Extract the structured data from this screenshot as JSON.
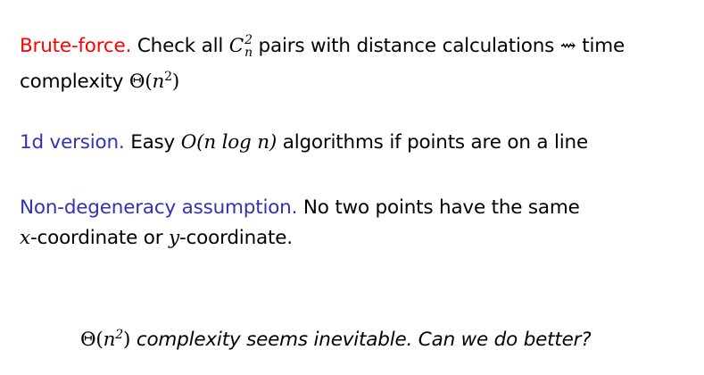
{
  "brute_force": {
    "heading": "Brute-force.",
    "text_before": "Check all",
    "math_C": "C",
    "math_sup": "2",
    "math_sub": "n",
    "text_after": "pairs with distance calculations",
    "arrow": "⇝",
    "text_end": "time complexity",
    "math_theta": "Θ(",
    "math_n": "n",
    "math_exp": "2",
    "math_close": ")"
  },
  "one_d": {
    "heading": "1d version.",
    "text_before": "Easy",
    "math": "O(n log n)",
    "text_after": "algorithms if points are on a line"
  },
  "non_degeneracy": {
    "heading": "Non-degeneracy assumption.",
    "text_before": "No two points have the same",
    "math_x": "x",
    "text_mid": "-coordinate or",
    "math_y": "y",
    "text_end": "-coordinate."
  },
  "question": {
    "math_theta": "Θ(",
    "math_n": "n",
    "math_exp": "2",
    "math_close": ")",
    "text": "complexity seems inevitable. Can we do better?"
  },
  "colors": {
    "red": "#ff0000",
    "blue": "#3333b2"
  }
}
